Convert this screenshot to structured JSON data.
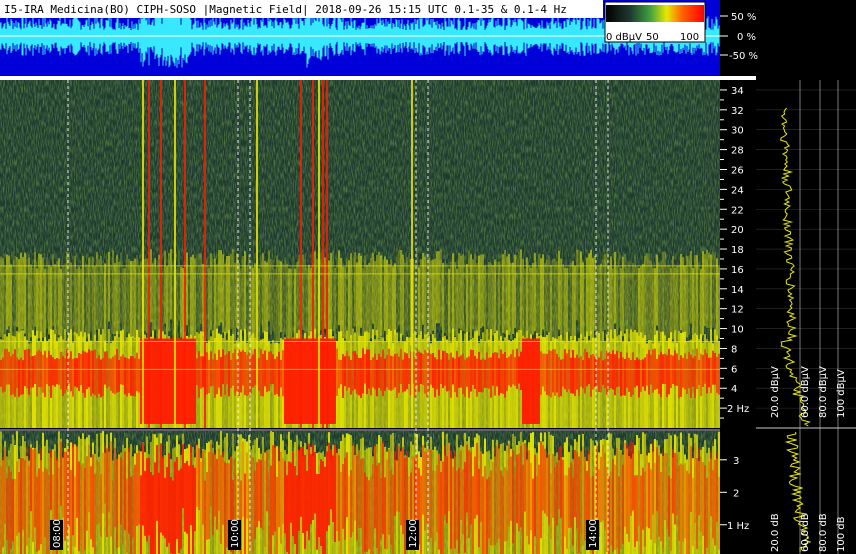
{
  "header": {
    "title": "I5-IRA Medicina(BO) CIPH-SOSO |Magnetic Field| 2018-09-26 15:15 UTC 0.1-35 & 0.1-4 Hz"
  },
  "colorbar": {
    "label_left": "0 dBμV",
    "label_mid": "50",
    "label_right": "100"
  },
  "waveform_axis": {
    "labels": [
      "50 %",
      "0 %",
      "-50 %"
    ]
  },
  "colors": {
    "panel_blue": "#0000d8",
    "wave_cyan": "#38e8ff",
    "separator": "#ffffff",
    "spectro_bg": "#1f3a30",
    "yellow": "#e8e800",
    "red": "#ff1a00",
    "grid": "#c8c8c8",
    "sidebar_bg": "#000000"
  },
  "chart_data": [
    {
      "type": "heatmap",
      "title": "",
      "xlabel": "UTC",
      "ylabel": "Hz",
      "ylim": [
        0,
        35
      ],
      "y_ticks": [
        2,
        4,
        6,
        8,
        10,
        12,
        14,
        16,
        18,
        20,
        22,
        24,
        26,
        28,
        30,
        32,
        34
      ],
      "y_tick_labels": [
        "2 Hz",
        "4",
        "6",
        "8",
        "10",
        "12",
        "14",
        "16",
        "18",
        "20",
        "22",
        "24",
        "26",
        "28",
        "30",
        "32",
        "34"
      ],
      "x_ticks": [
        "08:00",
        "10:00",
        "12:00",
        "14:00"
      ],
      "colorscale": {
        "label": "dBμV",
        "range": [
          0,
          100
        ]
      },
      "horizontal_lines_hz": [
        15.5,
        16.3,
        8.7,
        5.9
      ]
    },
    {
      "type": "heatmap",
      "title": "",
      "xlabel": "UTC",
      "ylabel": "Hz",
      "ylim": [
        0.1,
        4
      ],
      "y_ticks": [
        1,
        2,
        3
      ],
      "y_tick_labels": [
        "1 Hz",
        "2",
        "3"
      ]
    },
    {
      "type": "line",
      "title": "",
      "series": [],
      "x_labels": [
        "20.0 dBμV",
        "60.0 dBμV",
        "80.0 dBμV",
        "100 dBμV"
      ],
      "x_labels_lower": [
        "20.0 dB",
        "60.0 dB",
        "80.0 dB",
        "100 dB"
      ]
    }
  ],
  "y_labels_upper": [
    "34",
    "32",
    "30",
    "28",
    "26",
    "24",
    "22",
    "20",
    "18",
    "16",
    "14",
    "12",
    "10",
    "8",
    "6",
    "4",
    "2 Hz"
  ],
  "y_labels_lower": [
    "3",
    "2",
    "1 Hz"
  ],
  "time_labels": [
    "08:00",
    "10:00",
    "12:00",
    "14:00"
  ]
}
